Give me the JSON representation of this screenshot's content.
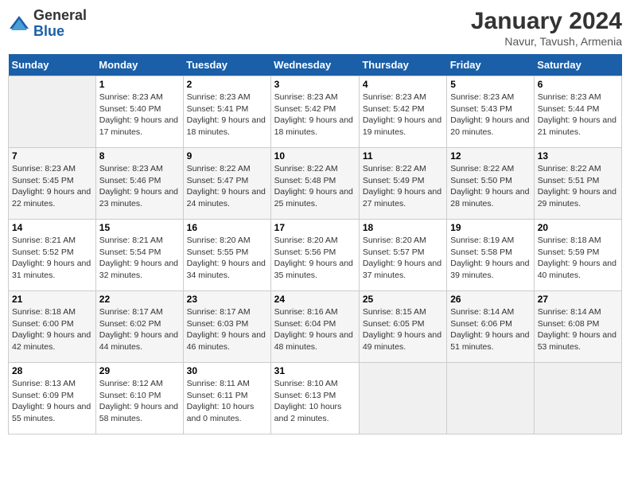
{
  "header": {
    "logo_general": "General",
    "logo_blue": "Blue",
    "month_year": "January 2024",
    "location": "Navur, Tavush, Armenia"
  },
  "weekdays": [
    "Sunday",
    "Monday",
    "Tuesday",
    "Wednesday",
    "Thursday",
    "Friday",
    "Saturday"
  ],
  "weeks": [
    [
      {
        "day": "",
        "sunrise": "",
        "sunset": "",
        "daylight": ""
      },
      {
        "day": "1",
        "sunrise": "8:23 AM",
        "sunset": "5:40 PM",
        "daylight": "9 hours and 17 minutes."
      },
      {
        "day": "2",
        "sunrise": "8:23 AM",
        "sunset": "5:41 PM",
        "daylight": "9 hours and 18 minutes."
      },
      {
        "day": "3",
        "sunrise": "8:23 AM",
        "sunset": "5:42 PM",
        "daylight": "9 hours and 18 minutes."
      },
      {
        "day": "4",
        "sunrise": "8:23 AM",
        "sunset": "5:42 PM",
        "daylight": "9 hours and 19 minutes."
      },
      {
        "day": "5",
        "sunrise": "8:23 AM",
        "sunset": "5:43 PM",
        "daylight": "9 hours and 20 minutes."
      },
      {
        "day": "6",
        "sunrise": "8:23 AM",
        "sunset": "5:44 PM",
        "daylight": "9 hours and 21 minutes."
      }
    ],
    [
      {
        "day": "7",
        "sunrise": "8:23 AM",
        "sunset": "5:45 PM",
        "daylight": "9 hours and 22 minutes."
      },
      {
        "day": "8",
        "sunrise": "8:23 AM",
        "sunset": "5:46 PM",
        "daylight": "9 hours and 23 minutes."
      },
      {
        "day": "9",
        "sunrise": "8:22 AM",
        "sunset": "5:47 PM",
        "daylight": "9 hours and 24 minutes."
      },
      {
        "day": "10",
        "sunrise": "8:22 AM",
        "sunset": "5:48 PM",
        "daylight": "9 hours and 25 minutes."
      },
      {
        "day": "11",
        "sunrise": "8:22 AM",
        "sunset": "5:49 PM",
        "daylight": "9 hours and 27 minutes."
      },
      {
        "day": "12",
        "sunrise": "8:22 AM",
        "sunset": "5:50 PM",
        "daylight": "9 hours and 28 minutes."
      },
      {
        "day": "13",
        "sunrise": "8:22 AM",
        "sunset": "5:51 PM",
        "daylight": "9 hours and 29 minutes."
      }
    ],
    [
      {
        "day": "14",
        "sunrise": "8:21 AM",
        "sunset": "5:52 PM",
        "daylight": "9 hours and 31 minutes."
      },
      {
        "day": "15",
        "sunrise": "8:21 AM",
        "sunset": "5:54 PM",
        "daylight": "9 hours and 32 minutes."
      },
      {
        "day": "16",
        "sunrise": "8:20 AM",
        "sunset": "5:55 PM",
        "daylight": "9 hours and 34 minutes."
      },
      {
        "day": "17",
        "sunrise": "8:20 AM",
        "sunset": "5:56 PM",
        "daylight": "9 hours and 35 minutes."
      },
      {
        "day": "18",
        "sunrise": "8:20 AM",
        "sunset": "5:57 PM",
        "daylight": "9 hours and 37 minutes."
      },
      {
        "day": "19",
        "sunrise": "8:19 AM",
        "sunset": "5:58 PM",
        "daylight": "9 hours and 39 minutes."
      },
      {
        "day": "20",
        "sunrise": "8:18 AM",
        "sunset": "5:59 PM",
        "daylight": "9 hours and 40 minutes."
      }
    ],
    [
      {
        "day": "21",
        "sunrise": "8:18 AM",
        "sunset": "6:00 PM",
        "daylight": "9 hours and 42 minutes."
      },
      {
        "day": "22",
        "sunrise": "8:17 AM",
        "sunset": "6:02 PM",
        "daylight": "9 hours and 44 minutes."
      },
      {
        "day": "23",
        "sunrise": "8:17 AM",
        "sunset": "6:03 PM",
        "daylight": "9 hours and 46 minutes."
      },
      {
        "day": "24",
        "sunrise": "8:16 AM",
        "sunset": "6:04 PM",
        "daylight": "9 hours and 48 minutes."
      },
      {
        "day": "25",
        "sunrise": "8:15 AM",
        "sunset": "6:05 PM",
        "daylight": "9 hours and 49 minutes."
      },
      {
        "day": "26",
        "sunrise": "8:14 AM",
        "sunset": "6:06 PM",
        "daylight": "9 hours and 51 minutes."
      },
      {
        "day": "27",
        "sunrise": "8:14 AM",
        "sunset": "6:08 PM",
        "daylight": "9 hours and 53 minutes."
      }
    ],
    [
      {
        "day": "28",
        "sunrise": "8:13 AM",
        "sunset": "6:09 PM",
        "daylight": "9 hours and 55 minutes."
      },
      {
        "day": "29",
        "sunrise": "8:12 AM",
        "sunset": "6:10 PM",
        "daylight": "9 hours and 58 minutes."
      },
      {
        "day": "30",
        "sunrise": "8:11 AM",
        "sunset": "6:11 PM",
        "daylight": "10 hours and 0 minutes."
      },
      {
        "day": "31",
        "sunrise": "8:10 AM",
        "sunset": "6:13 PM",
        "daylight": "10 hours and 2 minutes."
      },
      {
        "day": "",
        "sunrise": "",
        "sunset": "",
        "daylight": ""
      },
      {
        "day": "",
        "sunrise": "",
        "sunset": "",
        "daylight": ""
      },
      {
        "day": "",
        "sunrise": "",
        "sunset": "",
        "daylight": ""
      }
    ]
  ]
}
